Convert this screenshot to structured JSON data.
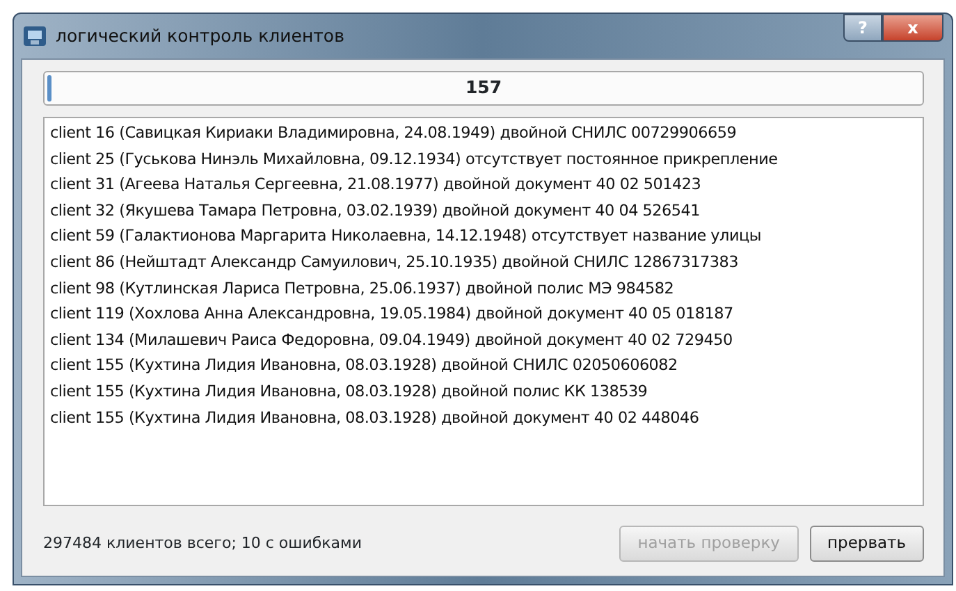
{
  "window": {
    "title": "логический контроль клиентов",
    "controls": [
      "?",
      "x"
    ]
  },
  "progress": {
    "text": "157",
    "level": 0.005
  },
  "log": [
    "client 16 (Савицкая Кириаки Владимировна, 24.08.1949) двойной СНИЛС 00729906659",
    "client 25 (Гуськова Нинэль Михайловна, 09.12.1934) отсутствует постоянное прикрепление",
    "client 31 (Агеева Наталья Сергеевна, 21.08.1977) двойной документ 40 02 501423",
    "client 32 (Якушева Тамара Петровна, 03.02.1939) двойной документ 40 04 526541",
    "client 59 (Галактионова Маргарита Николаевна, 14.12.1948) отсутствует название улицы",
    "client 86 (Нейштадт Александр Самуилович, 25.10.1935) двойной СНИЛС 12867317383",
    "client 98 (Кутлинская Лариса Петровна, 25.06.1937) двойной полис МЭ 984582",
    "client 119 (Хохлова Анна Александровна, 19.05.1984) двойной документ 40 05 018187",
    "client 134 (Милашевич Раиса Федоровна, 09.04.1949) двойной документ 40 02 729450",
    "client 155 (Кухтина Лидия Ивановна, 08.03.1928) двойной СНИЛС 02050606082",
    "client 155 (Кухтина Лидия Ивановна, 08.03.1928) двойной полис КК 138539",
    "client 155 (Кухтина Лидия Ивановна, 08.03.1928) двойной документ 40 02 448046"
  ],
  "status": "297484 клиентов всего; 10 с ошибками",
  "buttons": [
    {
      "label": "начать проверку",
      "disabled": true
    },
    {
      "label": "прервать",
      "disabled": false
    }
  ]
}
